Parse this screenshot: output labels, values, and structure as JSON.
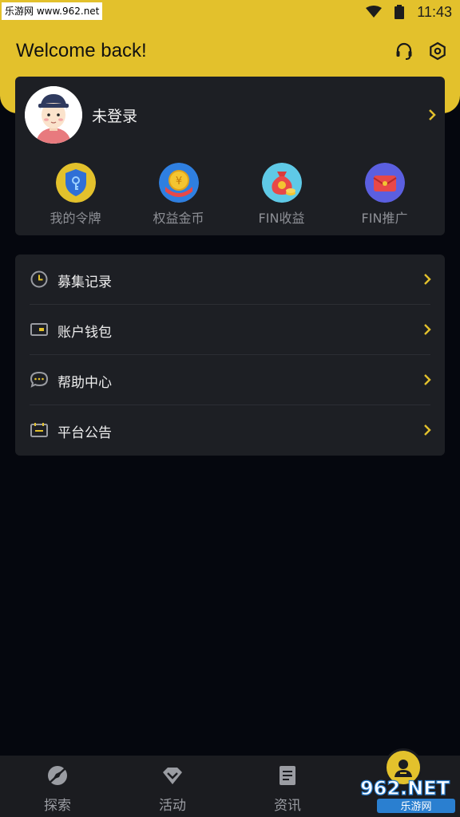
{
  "status_bar": {
    "watermark": "乐游网 www.962.net",
    "time": "11:43"
  },
  "header": {
    "title": "Welcome back!",
    "icons": [
      "headset-icon",
      "settings-icon"
    ]
  },
  "profile": {
    "login_status": "未登录",
    "quick_actions": [
      {
        "label": "我的令牌",
        "icon": "token-shield-icon"
      },
      {
        "label": "权益金币",
        "icon": "coin-icon"
      },
      {
        "label": "FIN收益",
        "icon": "money-bag-icon"
      },
      {
        "label": "FIN推广",
        "icon": "red-envelope-icon"
      }
    ]
  },
  "menu": {
    "items": [
      {
        "label": "募集记录",
        "icon": "clock-icon"
      },
      {
        "label": "账户钱包",
        "icon": "wallet-icon"
      },
      {
        "label": "帮助中心",
        "icon": "chat-icon"
      },
      {
        "label": "平台公告",
        "icon": "calendar-icon"
      }
    ]
  },
  "bottom_nav": {
    "items": [
      {
        "label": "探索",
        "icon": "explore-icon"
      },
      {
        "label": "活动",
        "icon": "diamond-icon"
      },
      {
        "label": "资讯",
        "icon": "document-icon"
      },
      {
        "label": "",
        "icon": "user-icon"
      }
    ],
    "watermark_text": "962.NET",
    "watermark_sub": "乐游网"
  },
  "colors": {
    "accent": "#e3c12c",
    "background": "#05070e",
    "card": "#1d1f24"
  }
}
